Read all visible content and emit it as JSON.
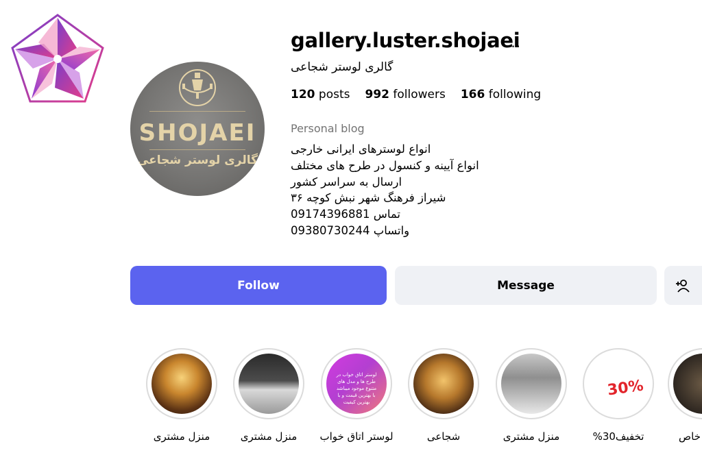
{
  "profile": {
    "username": "gallery.luster.shojaei",
    "more_icon": "...",
    "full_name": "گالری لوستر شجاعی",
    "stats": {
      "posts_count": "120",
      "posts_label": "posts",
      "followers_count": "992",
      "followers_label": "followers",
      "following_count": "166",
      "following_label": "following"
    },
    "category": "Personal blog",
    "bio_lines": [
      "انواع لوسترهای ایرانی خارجی",
      "انواع آیینه و کنسول در طرح های مختلف",
      "ارسال به سراسر کشور",
      "شیراز فرهنگ شهر نبش کوچه ۳۶",
      "تماس 09174396881",
      "واتساپ 09380730244"
    ],
    "avatar": {
      "brand_text": "SHOJAEI",
      "subtitle": "گالری لوستر شجاعی"
    }
  },
  "actions": {
    "follow_label": "Follow",
    "message_label": "Message",
    "add_user_icon": "person-add-icon"
  },
  "highlights": [
    {
      "label": "منزل مشتری",
      "style": "warm"
    },
    {
      "label": "منزل مشتری",
      "style": "room"
    },
    {
      "label": "لوستر اتاق خواب",
      "style": "pink",
      "inner_text": "لوستر اتاق خواب در طرح ها و مدل های متنوع موجود میباشد با بهترین قیمت و با بهترین کیفیت"
    },
    {
      "label": "شجاعی",
      "style": "gold"
    },
    {
      "label": "منزل مشتری",
      "style": "gray"
    },
    {
      "label": "تخفیف30%",
      "style": "white",
      "inner_text": "30%"
    },
    {
      "label": "خاص",
      "style": "dark"
    }
  ],
  "colors": {
    "follow_button": "#5b63ef",
    "secondary_button": "#eff1f5",
    "muted_text": "#737373"
  }
}
